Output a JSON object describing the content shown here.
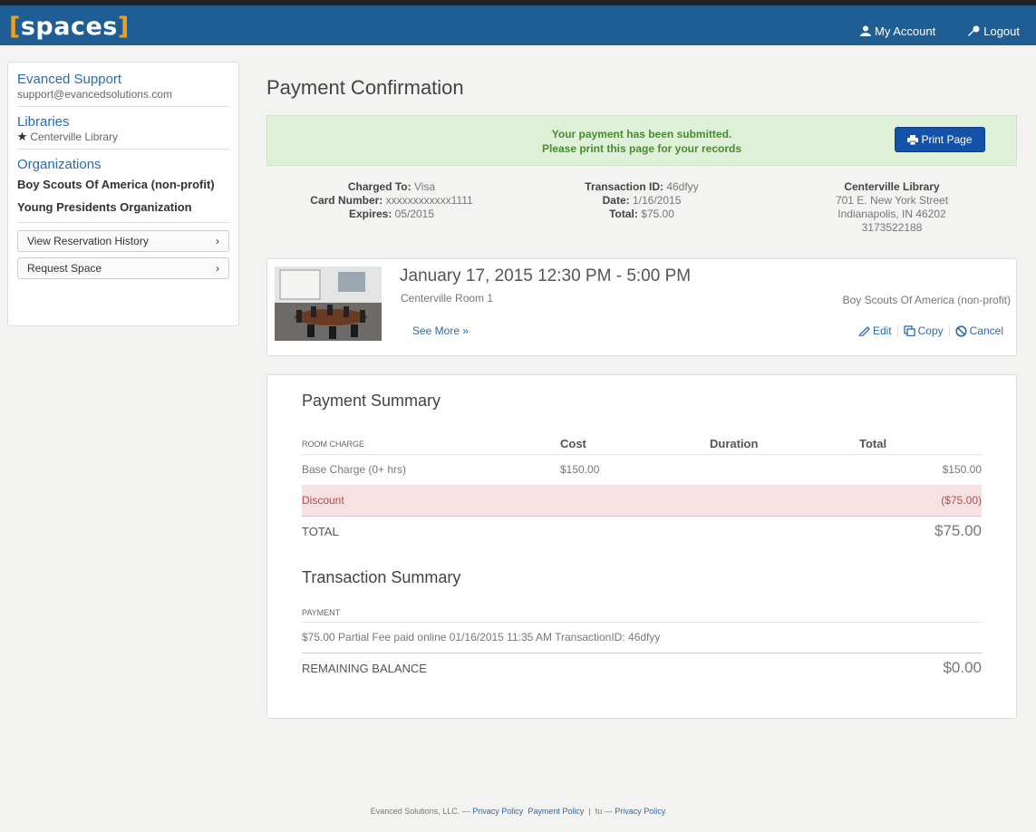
{
  "header": {
    "logo_text": "spaces",
    "my_account": "My Account",
    "logout": "Logout"
  },
  "sidebar": {
    "support_title": "Evanced Support",
    "support_email": "support@evancedsolutions.com",
    "libraries_title": "Libraries",
    "library_name": "Centerville Library",
    "organizations_title": "Organizations",
    "organizations": [
      "Boy Scouts Of America (non-profit)",
      "Young Presidents Organization"
    ],
    "buttons": [
      "View Reservation History",
      "Request Space"
    ]
  },
  "main": {
    "page_title": "Payment Confirmation",
    "alert_line1": "Your payment has been submitted.",
    "alert_line2": "Please print this page for your records",
    "print_button": "Print Page",
    "charge": {
      "charged_to_label": "Charged To:",
      "charged_to": "Visa",
      "card_number_label": "Card Number:",
      "card_number": "xxxxxxxxxxxx1111",
      "expires_label": "Expires:",
      "expires": "05/2015"
    },
    "transaction": {
      "id_label": "Transaction ID:",
      "id": "46dfyy",
      "date_label": "Date:",
      "date": "1/16/2015",
      "total_label": "Total:",
      "total": "$75.00"
    },
    "library": {
      "name": "Centerville Library",
      "street": "701 E. New York Street",
      "city": "Indianapolis, IN 46202",
      "phone": "3173522188"
    },
    "reservation": {
      "datetime": "January 17, 2015  12:30 PM - 5:00 PM",
      "room": "Centerville Room 1",
      "see_more": "See More »",
      "organization": "Boy Scouts Of America (non-profit)",
      "actions": [
        "Edit",
        "Copy",
        "Cancel"
      ]
    },
    "payment_summary": {
      "title": "Payment Summary",
      "headers": [
        "ROOM CHARGE",
        "Cost",
        "Duration",
        "Total"
      ],
      "rows": [
        {
          "label": "Base Charge (0+ hrs)",
          "cost": "$150.00",
          "duration": "",
          "total": "$150.00"
        },
        {
          "label": "Discount",
          "cost": "",
          "duration": "",
          "total": "($75.00)"
        }
      ],
      "total_label": "TOTAL",
      "total_value": "$75.00"
    },
    "transaction_summary": {
      "title": "Transaction Summary",
      "header": "PAYMENT",
      "payment_line": "$75.00 Partial Fee paid online 01/16/2015 11:35 AM TransactionID: 46dfyy",
      "balance_label": "REMAINING BALANCE",
      "balance_value": "$0.00"
    }
  },
  "footer": {
    "company": "Evanced Solutions, LLC.",
    "sep1": "—",
    "privacy1": "Privacy Policy",
    "payment_policy": "Payment Policy",
    "pipe": "|",
    "tu": "tu",
    "sep2": "—",
    "privacy2": "Privacy Policy"
  },
  "colors": {
    "header_bg": "#1f5e95",
    "logo_bracket": "#f0a020",
    "link": "#2a6aad",
    "success_bg": "#dff0d8",
    "primary_button": "#1452a8",
    "discount_bg": "#f7e1e1"
  }
}
